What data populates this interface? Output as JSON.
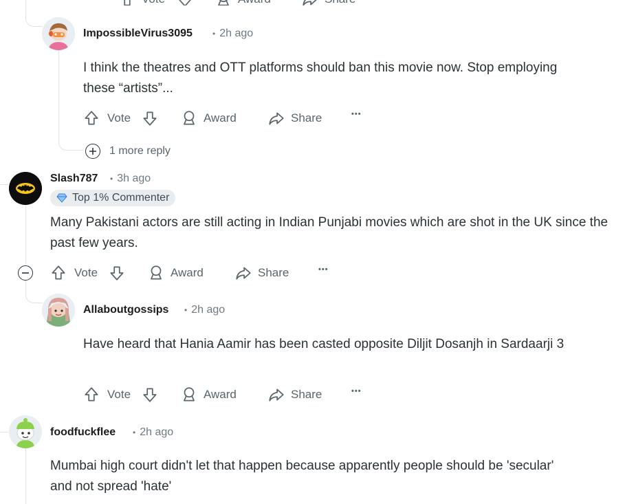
{
  "comments": [
    {
      "username": "ImpossibleVirus3095",
      "time": "2h ago",
      "body": "I think the theatres and OTT platforms should ban this movie now. Stop employing these “artists”...",
      "actions": {
        "vote": "Vote",
        "award": "Award",
        "share": "Share",
        "more": "•••"
      },
      "more_replies": "1 more reply"
    },
    {
      "username": "Slash787",
      "time": "3h ago",
      "badge": "Top 1% Commenter",
      "body": "Many Pakistani actors are still acting in Indian Punjabi movies which are shot in the UK since the past few years.",
      "actions": {
        "vote": "Vote",
        "award": "Award",
        "share": "Share",
        "more": "•••"
      }
    },
    {
      "username": "Allaboutgossips",
      "time": "2h ago",
      "body": "Have heard that Hania Aamir has been casted opposite Diljit Dosanjh in Sardaarji 3",
      "actions": {
        "vote": "Vote",
        "award": "Award",
        "share": "Share",
        "more": "•••"
      }
    },
    {
      "username": "foodfuckflee",
      "time": "2h ago",
      "body": "Mumbai high court didn't let that happen because apparently people should be 'secular' and not spread 'hate'"
    }
  ],
  "top_partial_actions": {
    "vote": "Vote",
    "award": "Award",
    "share": "Share"
  },
  "icons": {
    "upvote": "arrow-up-icon",
    "downvote": "arrow-down-icon",
    "award": "award-icon",
    "share": "share-icon",
    "expand": "plus-circle-icon",
    "collapse": "minus-circle-icon",
    "badge": "diamond-icon"
  },
  "colors": {
    "meta": "#6e7a80",
    "action": "#58656b",
    "thread": "#dfe3e6",
    "badge_bg": "#eaedef"
  }
}
